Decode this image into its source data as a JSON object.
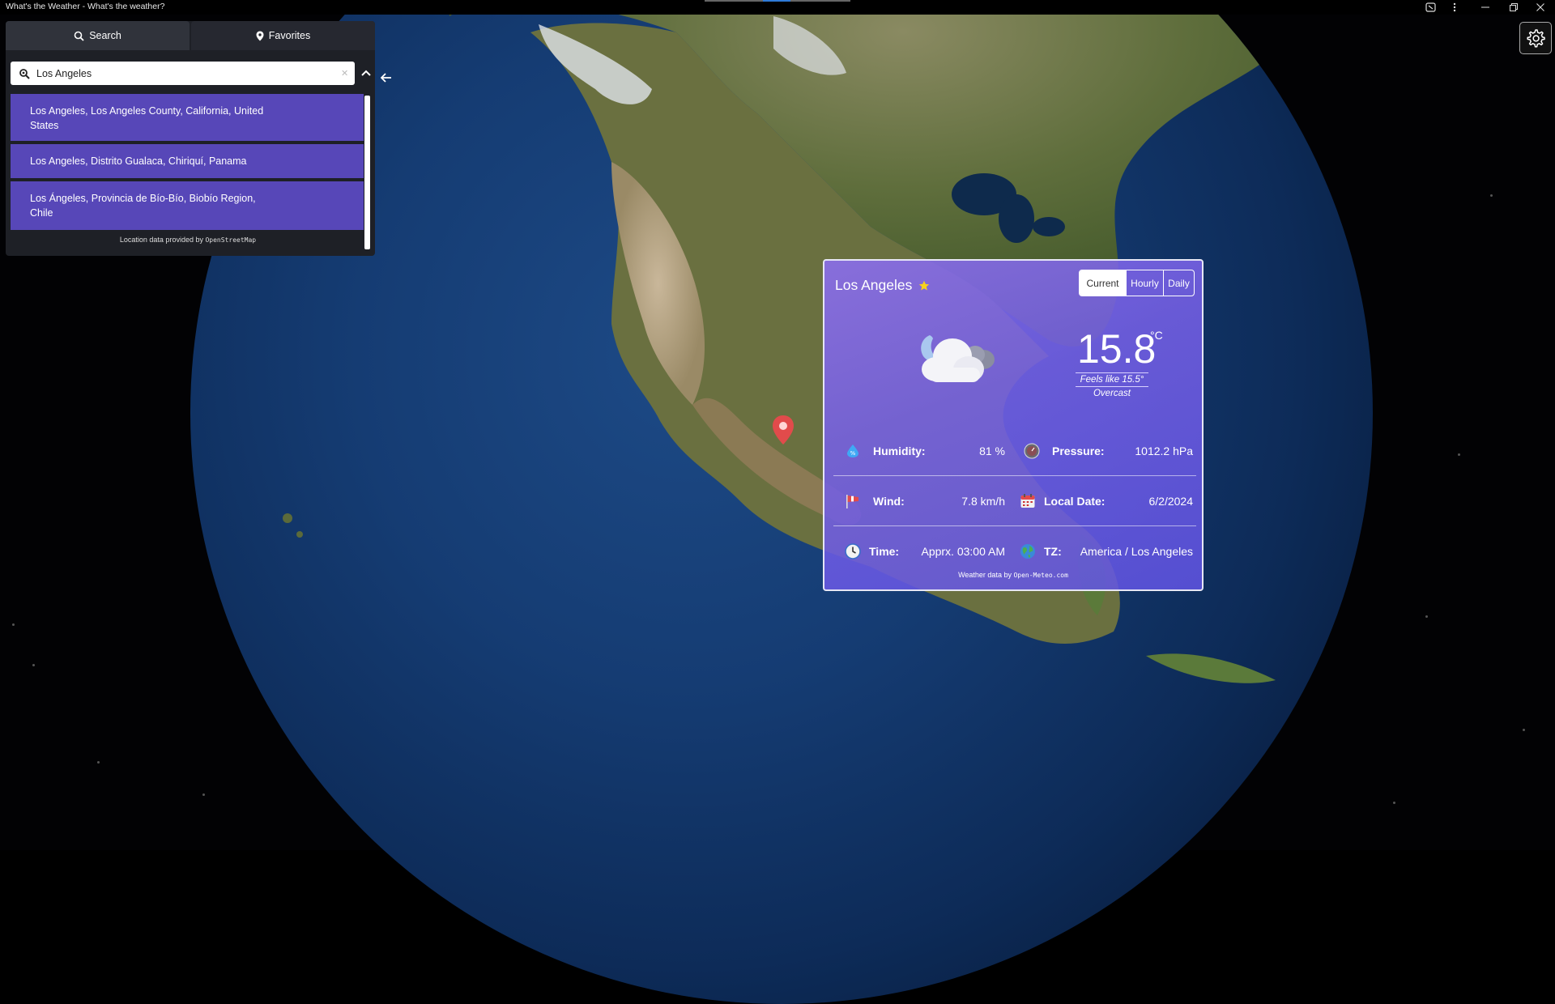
{
  "window": {
    "title": "What's the Weather - What's the weather?"
  },
  "search_panel": {
    "tabs": [
      {
        "label": "Search",
        "icon": "search-icon",
        "active": true
      },
      {
        "label": "Favorites",
        "icon": "map-pin-icon",
        "active": false
      }
    ],
    "search_value": "Los Angeles",
    "results": [
      {
        "label": "Los Angeles, Los Angeles County, California, United States"
      },
      {
        "label": "Los Angeles, Distrito Gualaca, Chiriquí, Panama"
      },
      {
        "label": "Los Ángeles, Provincia de Bío-Bío, Biobío Region, Chile"
      }
    ],
    "credit_text": "Location data provided by",
    "credit_source": "OpenStreetMap"
  },
  "weather_card": {
    "city": "Los Angeles",
    "favorite": true,
    "views": [
      {
        "label": "Current",
        "active": true
      },
      {
        "label": "Hourly",
        "active": false
      },
      {
        "label": "Daily",
        "active": false
      }
    ],
    "temperature": "15.8",
    "unit": "°C",
    "feels_like": "Feels like 15.5°",
    "condition": "Overcast",
    "condition_icon": "cloudy-night-icon",
    "details": {
      "humidity": {
        "label": "Humidity:",
        "value": "81 %"
      },
      "pressure": {
        "label": "Pressure:",
        "value": "1012.2 hPa"
      },
      "wind": {
        "label": "Wind:",
        "value": "7.8 km/h"
      },
      "local_date": {
        "label": "Local Date:",
        "value": "6/2/2024"
      },
      "time": {
        "label": "Time:",
        "value": "Apprx. 03:00 AM"
      },
      "tz": {
        "label": "TZ:",
        "value": "America / Los Angeles"
      }
    },
    "credit_text": "Weather data by",
    "credit_source": "Open-Meteo.com"
  },
  "colors": {
    "accent": "#5747b8",
    "card": "#7a64e6",
    "panel": "#1e2026"
  }
}
